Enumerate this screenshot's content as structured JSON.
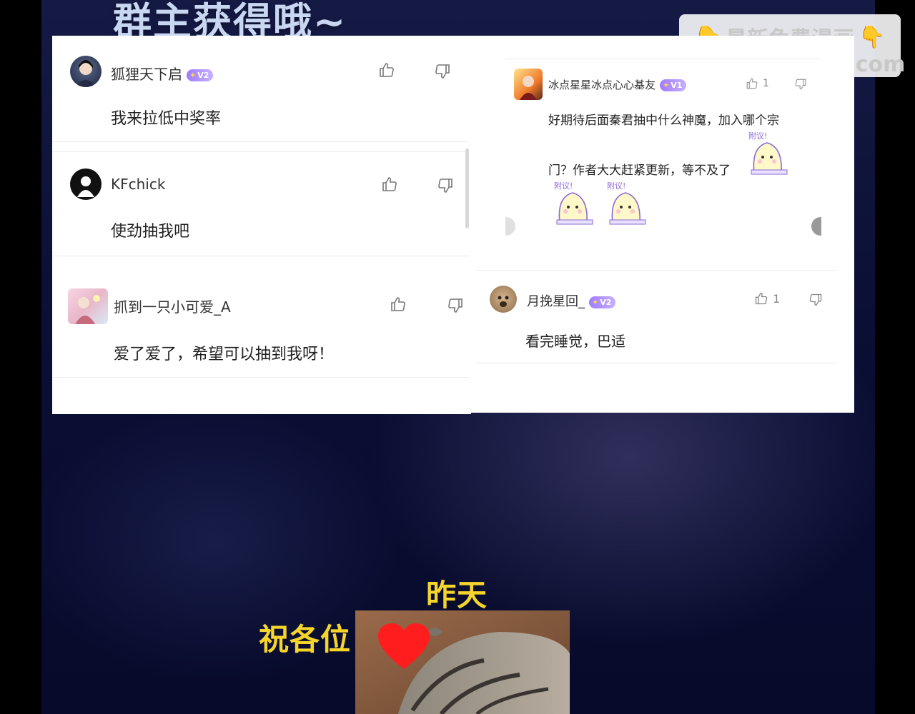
{
  "page": {
    "headline": "群主获得哦~",
    "watermark": {
      "line1": "最新免费漫画",
      "line2": "www.baozimh.com"
    }
  },
  "comments_left": [
    {
      "username": "狐狸天下启",
      "badge": "V2",
      "text": "我来拉低中奖率",
      "likes": ""
    },
    {
      "username": "KFchick",
      "badge": "",
      "text": "使劲抽我吧",
      "likes": ""
    },
    {
      "username": "抓到一只小可爱_A",
      "badge": "",
      "text": "爱了爱了，希望可以抽到我呀！",
      "likes": ""
    }
  ],
  "comments_right": [
    {
      "username": "冰点星星冰点心心基友",
      "badge": "V1",
      "text_line1": "好期待后面秦君抽中什么神魔，加入哪个宗",
      "text_line2": "门？作者大大赶紧更新，等不及了",
      "likes": "1",
      "sticker_label": "附议!"
    },
    {
      "username": "月挽星回_",
      "badge": "V2",
      "text": "看完睡觉，巴适",
      "likes": "1"
    }
  ],
  "bottom": {
    "top_text": "昨天",
    "side_text": "祝各位"
  },
  "colors": {
    "accent_yellow": "#f6d52b",
    "badge_purple": "#9f7bff",
    "heart_red": "#ff1d1d"
  }
}
